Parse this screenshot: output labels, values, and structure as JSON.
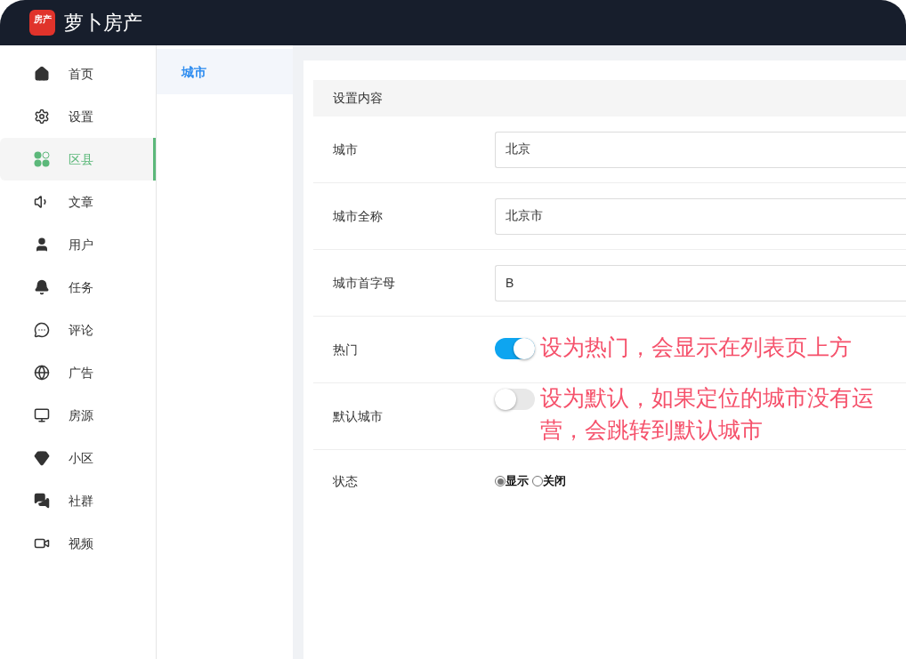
{
  "app": {
    "logo_text": "房产",
    "title": "萝卜房产"
  },
  "sidebar": {
    "items": [
      {
        "label": "首页",
        "selected": false
      },
      {
        "label": "设置",
        "selected": false
      },
      {
        "label": "区县",
        "selected": true
      },
      {
        "label": "文章",
        "selected": false
      },
      {
        "label": "用户",
        "selected": false
      },
      {
        "label": "任务",
        "selected": false
      },
      {
        "label": "评论",
        "selected": false
      },
      {
        "label": "广告",
        "selected": false
      },
      {
        "label": "房源",
        "selected": false
      },
      {
        "label": "小区",
        "selected": false
      },
      {
        "label": "社群",
        "selected": false
      },
      {
        "label": "视频",
        "selected": false
      }
    ]
  },
  "subnav": {
    "items": [
      {
        "label": "城市",
        "selected": true
      }
    ]
  },
  "form": {
    "section_title": "设置内容",
    "rows": [
      {
        "kind": "text",
        "label": "城市",
        "value": "北京"
      },
      {
        "kind": "text",
        "label": "城市全称",
        "value": "北京市"
      },
      {
        "kind": "text",
        "label": "城市首字母",
        "value": "B"
      },
      {
        "kind": "toggle",
        "label": "热门",
        "on": true,
        "annotation": "设为热门，会显示在列表页上方"
      },
      {
        "kind": "toggle",
        "label": "默认城市",
        "on": false,
        "annotation": "设为默认，如果定位的城市没有运营，会跳转到默认城市"
      },
      {
        "kind": "radio",
        "label": "状态",
        "options": [
          {
            "label": "显示",
            "selected": true
          },
          {
            "label": "关闭",
            "selected": false
          }
        ]
      }
    ]
  }
}
